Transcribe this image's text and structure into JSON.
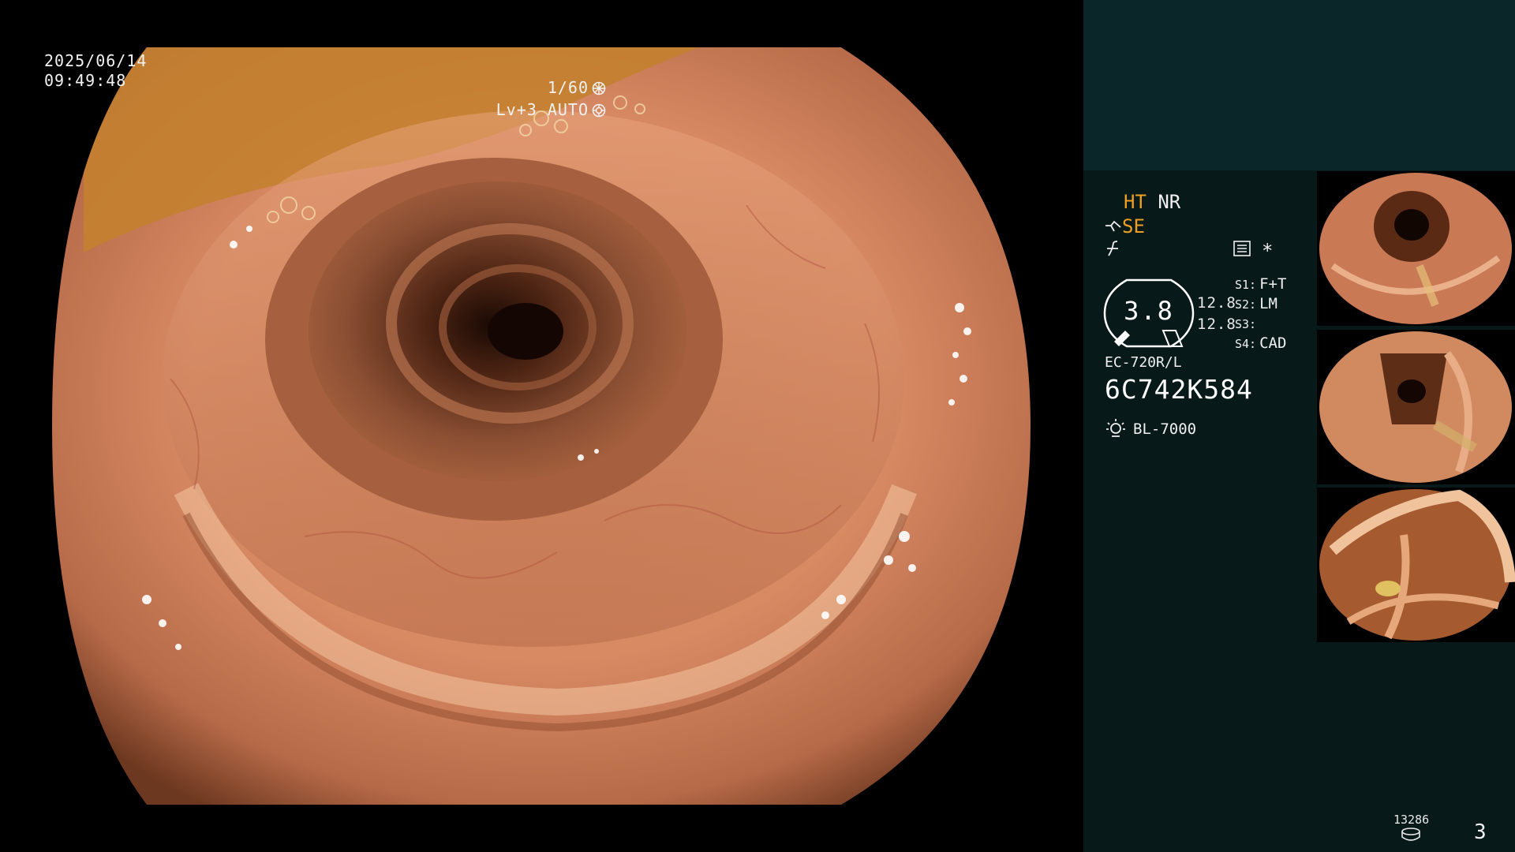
{
  "osd": {
    "date": "2025/06/14",
    "time": "09:49:48",
    "shutter": "1/60",
    "shutter_icon": "shutter-icon",
    "iris": "Lv+3 AUTO",
    "iris_icon": "iris-icon"
  },
  "status": {
    "ht": "HT",
    "nr": "NR",
    "se": "SE",
    "se_icon": "enhancement-wave-icon",
    "f_icon": "freeze-icon",
    "menu_icon": "settings-list-icon",
    "asterisk": "*",
    "brightness": "3.8",
    "value_1": "12.8",
    "value_2": "12.8"
  },
  "switches": [
    {
      "key": "S1:",
      "value": "F+T"
    },
    {
      "key": "S2:",
      "value": "LM"
    },
    {
      "key": "S3:",
      "value": ""
    },
    {
      "key": "S4:",
      "value": "CAD"
    }
  ],
  "scope": {
    "model": "EC-720R/L",
    "serial": "6C742K584",
    "light_icon": "light-source-icon",
    "light_source": "BL-7000"
  },
  "capture": {
    "count": "13286",
    "disk_icon": "disk-icon",
    "page": "3"
  },
  "colors": {
    "panel_top": "#0a2628",
    "panel": "#08191a",
    "amber": "#f0a020",
    "text": "#f0f0f0"
  }
}
